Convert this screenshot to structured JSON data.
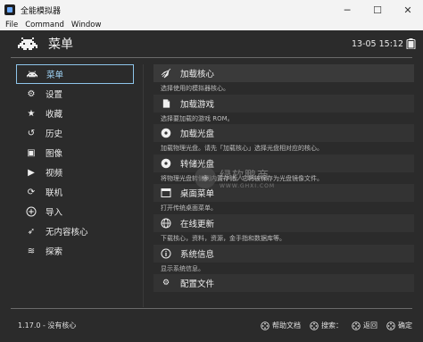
{
  "window": {
    "title": "全能模拟器",
    "controls": {
      "minimize": "─",
      "maximize": "☐",
      "close": "✕"
    }
  },
  "menubar": [
    "File",
    "Command",
    "Window"
  ],
  "header": {
    "title": "菜单",
    "clock": "13-05 15:12"
  },
  "sidebar": {
    "items": [
      {
        "label": "菜单",
        "icon": "space-invader-icon",
        "glyph": "👾",
        "active": true
      },
      {
        "label": "设置",
        "icon": "gear-icon",
        "glyph": "⚙"
      },
      {
        "label": "收藏",
        "icon": "star-icon",
        "glyph": "★"
      },
      {
        "label": "历史",
        "icon": "history-icon",
        "glyph": "↺"
      },
      {
        "label": "图像",
        "icon": "image-icon",
        "glyph": "▣"
      },
      {
        "label": "视频",
        "icon": "video-icon",
        "glyph": "▶"
      },
      {
        "label": "联机",
        "icon": "netplay-icon",
        "glyph": "⟳"
      },
      {
        "label": "导入",
        "icon": "add-icon",
        "glyph": "+"
      },
      {
        "label": "无内容核心",
        "icon": "rocket-icon",
        "glyph": "➶"
      },
      {
        "label": "探索",
        "icon": "database-icon",
        "glyph": "≋"
      }
    ]
  },
  "main": {
    "entries": [
      {
        "label": "加载核心",
        "desc": "选择使用的模拟器核心。",
        "icon": "core-icon",
        "glyph": "🚀"
      },
      {
        "label": "加载游戏",
        "desc": "选择要加载的游戏 ROM。",
        "icon": "file-icon",
        "glyph": "▤"
      },
      {
        "label": "加载光盘",
        "desc": "加载物理光盘。请先「加载核心」选择光盘相对应的核心。",
        "icon": "disc-icon",
        "glyph": "◉"
      },
      {
        "label": "转储光盘",
        "desc": "将物理光盘转储到内置存储。它将被保存为光盘镜像文件。",
        "icon": "dump-disc-icon",
        "glyph": "◉"
      },
      {
        "label": "桌面菜单",
        "desc": "打开传统桌面菜单。",
        "icon": "desktop-menu-icon",
        "glyph": "▬"
      },
      {
        "label": "在线更新",
        "desc": "下载核心，资料，资源，金手指和数据库等。",
        "icon": "globe-icon",
        "glyph": "⊕"
      },
      {
        "label": "系统信息",
        "desc": "显示系统信息。",
        "icon": "info-icon",
        "glyph": "ⓘ"
      },
      {
        "label": "配置文件",
        "desc": "",
        "icon": "config-icon",
        "glyph": "⚙"
      }
    ]
  },
  "watermark": {
    "big": "绿软鹏商",
    "small": "WWW.GHXI.COM",
    "badge": "◈"
  },
  "footer": {
    "version": "1.17.0 - 没有核心",
    "hints": [
      {
        "label": "帮助文档",
        "icon": "help-icon"
      },
      {
        "label": "搜索：",
        "icon": "search-icon"
      },
      {
        "label": "返回",
        "icon": "back-icon"
      },
      {
        "label": "确定",
        "icon": "ok-icon"
      }
    ]
  },
  "colors": {
    "accent": "#8ec5ea",
    "background": "#2b2b2b"
  }
}
